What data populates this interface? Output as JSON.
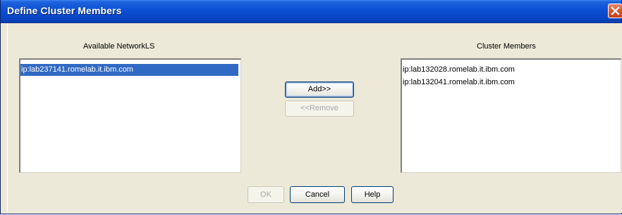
{
  "window": {
    "title": "Define Cluster Members",
    "close_icon": "close-icon"
  },
  "available": {
    "label": "Available NetworkLS",
    "items": [
      {
        "text": "ip:lab237141.romelab.it.ibm.com",
        "selected": true
      }
    ]
  },
  "members": {
    "label": "Cluster Members",
    "items": [
      {
        "text": "ip:lab132028.romelab.it.ibm.com",
        "selected": false
      },
      {
        "text": "ip:lab132041.romelab.it.ibm.com",
        "selected": false
      }
    ]
  },
  "transfer": {
    "add_label": "Add>>",
    "remove_label": "<<Remove",
    "remove_enabled": false
  },
  "footer": {
    "ok_label": "OK",
    "ok_enabled": false,
    "cancel_label": "Cancel",
    "help_label": "Help"
  },
  "colors": {
    "titlebar": "#0a4fd3",
    "selection": "#316ac5",
    "close": "#d95a35"
  }
}
